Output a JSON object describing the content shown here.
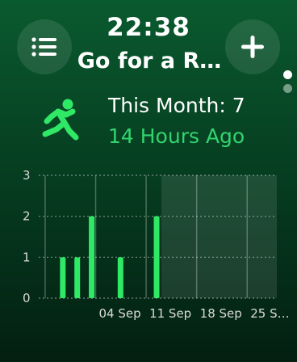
{
  "header": {
    "time": "22:38",
    "title": "Go for a R…"
  },
  "buttons": {
    "menu_icon": "list-icon",
    "add_icon": "plus-icon"
  },
  "summary": {
    "this_month": "This Month: 7",
    "last_activity": "14 Hours Ago"
  },
  "colors": {
    "accent": "#33d46e",
    "bar": "#2ee866",
    "background_top": "#0a5a2f",
    "background_bottom": "#031f11"
  },
  "pagination": {
    "pages": 2,
    "current": 1
  },
  "chart_data": {
    "type": "bar",
    "title": "",
    "xlabel": "",
    "ylabel": "",
    "ylim": [
      0,
      3
    ],
    "yticks": [
      "0",
      "1",
      "2",
      "3"
    ],
    "xticks": [
      "04 Sep",
      "11 Sep",
      "18 Sep",
      "25 S…"
    ],
    "x": [
      "2023-08-30",
      "2023-09-01",
      "2023-09-03",
      "2023-09-07",
      "2023-09-12"
    ],
    "values": [
      1,
      1,
      2,
      1,
      2
    ],
    "future_region_start": "2023-09-13"
  }
}
